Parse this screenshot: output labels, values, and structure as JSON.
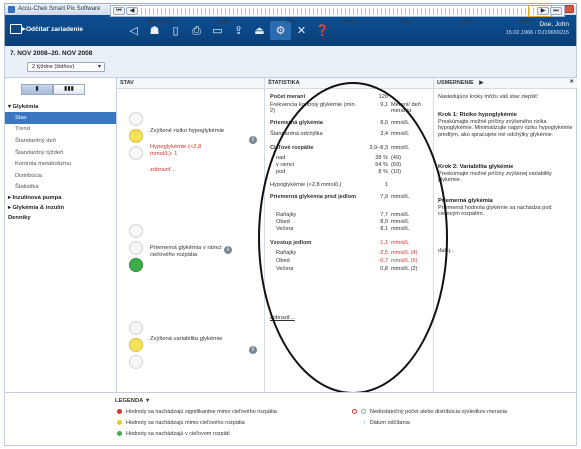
{
  "window": {
    "title": "Accu-Chek Smart Pix Software"
  },
  "toolbar": {
    "connect_label": "Odčítať zariadenie",
    "icons": [
      "back-icon",
      "export-icon",
      "document-icon",
      "print-icon",
      "save-icon",
      "send-icon",
      "upload-icon",
      "settings-icon",
      "tools-icon",
      "help-icon"
    ]
  },
  "user": {
    "name": "Doe, John",
    "id": "15.02.1966 / DJ19669215"
  },
  "period": {
    "range": "7. NOV 2008–20. NOV 2008",
    "selected": "2 týždne (štdňov)",
    "months": [
      "MÁJ 2008",
      "JÚN",
      "JÚL",
      "AUG",
      "SEP",
      "OKT",
      "NOV"
    ]
  },
  "sidebar": {
    "toggle": [
      "▮",
      "▮▮▮"
    ],
    "groups": [
      {
        "label": "▾ Glykémia",
        "items": [
          "Stav",
          "Trend",
          "Štandardný deň",
          "Štandardný týždeň",
          "Kontrola metabolizmu",
          "Distribúcia",
          "Štatistika"
        ]
      },
      {
        "label": "▸ Inzulínová pumpa",
        "items": []
      },
      {
        "label": "▸ Glykémia & inzulín",
        "items": []
      },
      {
        "label": "Denníky",
        "items": []
      }
    ],
    "selected_item": "Stav"
  },
  "stav": {
    "header": "STAV",
    "hypo_title": "Zvýšené riziko hypoglykémie",
    "hypo_detail": "Hypoglykémie (<2,8 mmol/L): 1",
    "hypo_link": "zobraziť...",
    "mean_title": "Priemerná glykémia v rámci cieľového rozpätia",
    "variability_title": "Zvýšená variabilita glykémie"
  },
  "statistics": {
    "header": "ŠTATISTIKA",
    "rows": [
      {
        "label": "Počet meraní",
        "value": "128",
        "unit": "",
        "bold": true
      },
      {
        "label": "Frekvencia kontroly glykémie (min. 2)",
        "value": "9,1",
        "unit": "Meraní/ deň merania",
        "bold": false
      },
      {
        "label": "Priemerná glykémia",
        "value": "8,0",
        "unit": "mmol/L",
        "bold": true
      },
      {
        "label": "Štandardná odchýlka",
        "value": "3,4",
        "unit": "mmol/L",
        "bold": false
      },
      {
        "label": "Cieľové rozpätie",
        "value": "3,9–8,3",
        "unit": "mmol/L",
        "bold": true
      },
      {
        "label": "nad",
        "value": "38 %",
        "unit": "(49)",
        "indent": true
      },
      {
        "label": "v rámci",
        "value": "54 %",
        "unit": "(69)",
        "indent": true
      },
      {
        "label": "pod",
        "value": "8 %",
        "unit": "(10)",
        "indent": true
      },
      {
        "label": "Hypoglykémie (<2,8 mmol/L)",
        "value": "1",
        "unit": ""
      },
      {
        "label": "Priemerná glykémia pred jedlom",
        "value": "7,9",
        "unit": "mmol/L",
        "bold": true
      },
      {
        "label": "Raňajky",
        "value": "7,7",
        "unit": "mmol/L",
        "indent": true
      },
      {
        "label": "Obed",
        "value": "8,0",
        "unit": "mmol/L",
        "indent": true
      },
      {
        "label": "Večera",
        "value": "8,1",
        "unit": "mmol/L",
        "indent": true
      },
      {
        "label": "Vzostup jedlom",
        "value": "-1,1",
        "unit": "mmol/L",
        "bold": true,
        "red": true
      },
      {
        "label": "Raňajky",
        "value": "-2,5",
        "unit": "mmol/L (4)",
        "indent": true,
        "red": true
      },
      {
        "label": "Obed",
        "value": "-0,7",
        "unit": "mmol/L (5)",
        "indent": true,
        "red": true
      },
      {
        "label": "Večera",
        "value": "0,8",
        "unit": "mmol/L (2)",
        "indent": true
      }
    ],
    "link": "zobraziť..."
  },
  "recommendation": {
    "header": "USMERNENIE",
    "intro": "Nasledujúce kroky môžu váš stav zlepšiť:",
    "step1_title": "Krok 1: Riziko hypoglykémie",
    "step1_text": "Preskúmajte možné príčiny zvýšeného rizika hypoglykémie. Minimalizujte najprv riziko hypoglykémie predtým, ako spracujete iné odchýlky glykémie.",
    "step2_title": "Krok 2: Variabilita glykémie",
    "step2_text": "Preskúmajte možné príčiny zvýšenej variability glykémie.",
    "mean_title": "Priemerná glykémia",
    "mean_text": "Priemerná hodnota glykémie sa nachádza pod cieľovým rozpätím.",
    "more": "ďalej..."
  },
  "legend": {
    "header": "LEGENDA",
    "items": [
      "Hodnoty sa nachádzajú signifikantne mimo cieľového rozpätia",
      "Hodnoty sa nachádzajú mimo cieľového rozpätia",
      "Hodnoty sa nachádzajú v cieľovom rozpätí",
      "Nedostatočný počet alebo distribúcia výsledkov merania",
      "Dátum odčítania"
    ]
  },
  "colors": {
    "toolbar": "#0d4f92",
    "selection": "#3a77c2",
    "red": "#d6342f",
    "yellow": "#e8c92b",
    "green": "#3fae4a"
  }
}
